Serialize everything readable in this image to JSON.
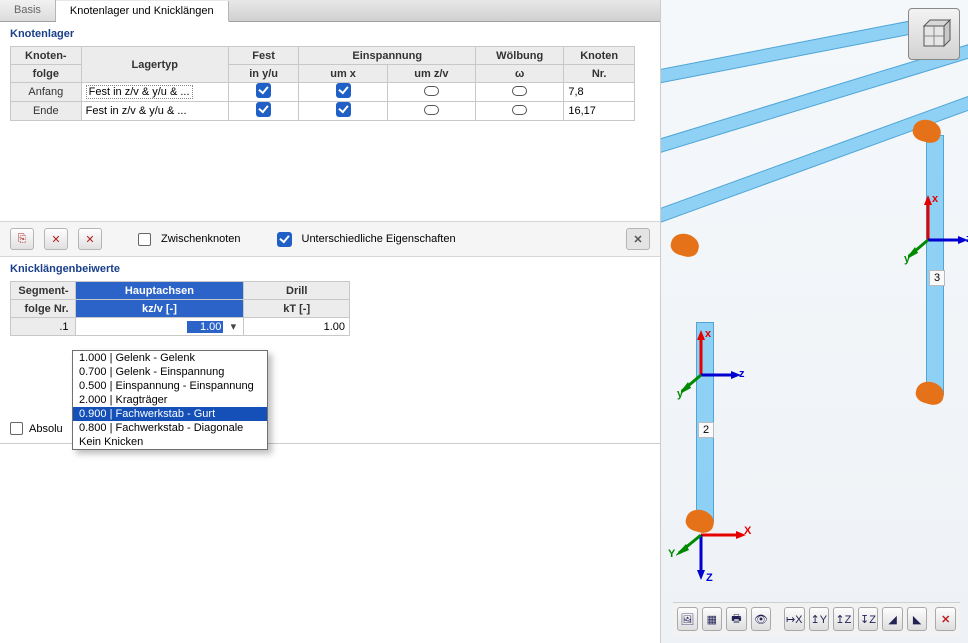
{
  "tabs": {
    "basis": "Basis",
    "knotenlager": "Knotenlager und Knicklängen"
  },
  "section1": {
    "title": "Knotenlager",
    "headers": {
      "knotenfolge_l1": "Knoten-",
      "knotenfolge_l2": "folge",
      "lagertyp": "Lagertyp",
      "fest_l1": "Fest",
      "fest_l2": "in y/u",
      "einsp_group": "Einspannung",
      "einsp_x": "um x",
      "einsp_zv": "um z/v",
      "woelb_l1": "Wölbung",
      "woelb_l2": "ω",
      "knoten_l1": "Knoten",
      "knoten_l2": "Nr."
    },
    "rows": [
      {
        "folge": "Anfang",
        "lagertyp": "Fest in z/v & y/u & ...",
        "fest": true,
        "ex": true,
        "ezv": false,
        "wo": false,
        "kn": "7,8"
      },
      {
        "folge": "Ende",
        "lagertyp": "Fest in z/v & y/u & ...",
        "fest": true,
        "ex": true,
        "ezv": false,
        "wo": false,
        "kn": "16,17"
      }
    ],
    "zwischen_label": "Zwischenknoten",
    "unterschied_label": "Unterschiedliche Eigenschaften"
  },
  "section2": {
    "title": "Knicklängenbeiwerte",
    "headers": {
      "segment_l1": "Segment-",
      "segment_l2": "folge Nr.",
      "haupt_group": "Hauptachsen",
      "haupt_sub": "kz/v [-]",
      "drill_group": "Drill",
      "drill_sub": "kT [-]"
    },
    "row_id": ".1",
    "row_kz": "1.00",
    "row_kt": "1.00",
    "dropdown": [
      "1.000 | Gelenk - Gelenk",
      "0.700 | Gelenk - Einspannung",
      "0.500 | Einspannung - Einspannung",
      "2.000 | Kragträger",
      "0.900 | Fachwerkstab - Gurt",
      "0.800 | Fachwerkstab - Diagonale",
      "Kein Knicken"
    ],
    "abs_label": "Absolute Werte"
  },
  "viewport": {
    "member_labels": {
      "m2": "2",
      "m3": "3"
    },
    "axes": {
      "x": "x",
      "y": "y",
      "z": "z",
      "X": "X",
      "Y": "Y",
      "Z": "Z"
    }
  },
  "toolbar": {
    "icons": [
      "view1",
      "view2",
      "print",
      "eye",
      "axis-x",
      "axis-y",
      "axis-z",
      "axis-nz",
      "iso1",
      "iso2"
    ],
    "close_icon": "power-off"
  }
}
